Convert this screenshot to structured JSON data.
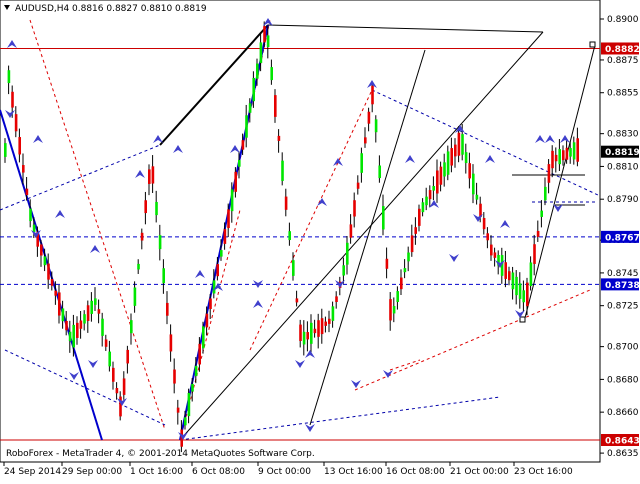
{
  "header": {
    "symbol": "AUDUSD,H4",
    "ohlc": "0.8816 0.8827 0.8810 0.8819"
  },
  "footer": {
    "watermark": "RoboForex - MetaTrader 4, © 2001-2014 MetaQuotes Software Corp."
  },
  "colors": {
    "bull": "#00e600",
    "bear": "#e60000",
    "wick": "#000000",
    "level_line": "#cc0000",
    "hline_blue": "#0000cc",
    "trend_blue": "#0000cc",
    "arrow": "#4040cc",
    "price_tag_blue": "#0000cc",
    "price_tag_red": "#cc0000",
    "price_tag_black": "#000000"
  },
  "axis": {
    "price_ticks": [
      "0.8900",
      "0.8875",
      "0.8855",
      "0.8830",
      "0.8810",
      "0.8790",
      "0.8765",
      "0.8745",
      "0.8725",
      "0.8700",
      "0.8680",
      "0.8660",
      "0.8635"
    ],
    "date_ticks": [
      "24 Sep 2014",
      "29 Sep 00:00",
      "1 Oct 16:00",
      "6 Oct 08:00",
      "9 Oct 00:00",
      "13 Oct 16:00",
      "16 Oct 08:00",
      "21 Oct 00:00",
      "23 Oct 16:00"
    ]
  },
  "price_tags": [
    {
      "text": "0.8882",
      "kind": "red"
    },
    {
      "text": "0.8819",
      "kind": "black"
    },
    {
      "text": "0.8767",
      "kind": "blue"
    },
    {
      "text": "0.8738",
      "kind": "blue"
    },
    {
      "text": "0.8643",
      "kind": "red"
    }
  ]
}
